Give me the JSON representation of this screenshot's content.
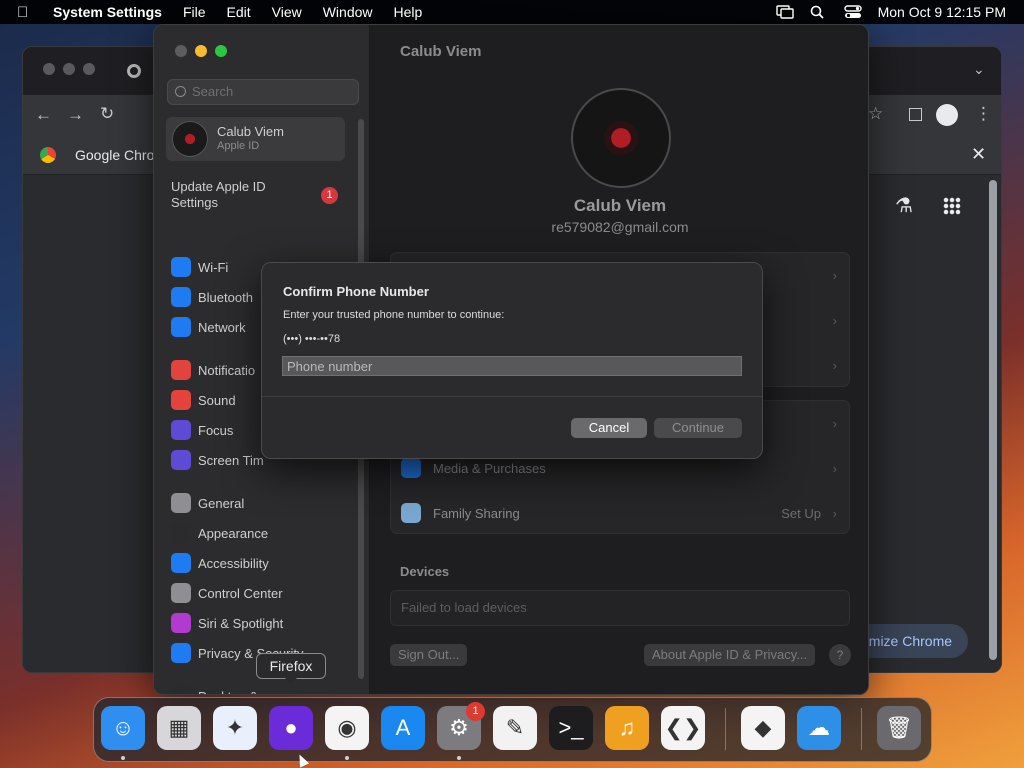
{
  "menubar": {
    "app": "System Settings",
    "items": [
      "File",
      "Edit",
      "View",
      "Window",
      "Help"
    ],
    "clock": "Mon Oct 9  12:15 PM"
  },
  "chrome": {
    "bookmark": "Google Chrom",
    "customize": "omize Chrome"
  },
  "settings": {
    "title": "Calub Viem",
    "search_placeholder": "Search",
    "account": {
      "name": "Calub Viem",
      "sub": "Apple ID"
    },
    "update": {
      "label": "Update Apple ID Settings",
      "badge": "1"
    },
    "sidebar": [
      {
        "label": "Wi-Fi",
        "icon": "wifi-icon",
        "color": "#1f7bf2"
      },
      {
        "label": "Bluetooth",
        "icon": "bluetooth-icon",
        "color": "#1f7bf2"
      },
      {
        "label": "Network",
        "icon": "globe-icon",
        "color": "#1f7bf2"
      },
      {
        "label": "Notificatio",
        "icon": "bell-icon",
        "color": "#e2443d"
      },
      {
        "label": "Sound",
        "icon": "speaker-icon",
        "color": "#e2443d"
      },
      {
        "label": "Focus",
        "icon": "moon-icon",
        "color": "#5d4bd6"
      },
      {
        "label": "Screen Tim",
        "icon": "hourglass-icon",
        "color": "#5d4bd6"
      },
      {
        "label": "General",
        "icon": "gear-icon",
        "color": "#8e8e93"
      },
      {
        "label": "Appearance",
        "icon": "appearance-icon",
        "color": "#2b2b2d"
      },
      {
        "label": "Accessibility",
        "icon": "accessibility-icon",
        "color": "#1f7bf2"
      },
      {
        "label": "Control Center",
        "icon": "control-center-icon",
        "color": "#8e8e93"
      },
      {
        "label": "Siri & Spotlight",
        "icon": "siri-icon",
        "color": "#b23ad1"
      },
      {
        "label": "Privacy & Security",
        "icon": "hand-icon",
        "color": "#1f7bf2"
      },
      {
        "label": "Desktop &",
        "icon": "desktop-icon",
        "color": "#2b2b2d"
      }
    ],
    "profile": {
      "name": "Calub Viem",
      "email": "re579082@gmail.com"
    },
    "rows": [
      {
        "label": "Media & Purchases",
        "value": ""
      },
      {
        "label": "Family Sharing",
        "value": "Set Up"
      }
    ],
    "devices_heading": "Devices",
    "devices_failed": "Failed to load devices",
    "sign_out": "Sign Out...",
    "about": "About Apple ID & Privacy...",
    "help": "?"
  },
  "dialog": {
    "title": "Confirm Phone Number",
    "text": "Enter your trusted phone number to continue:",
    "masked": "(•••) •••-••78",
    "placeholder": "Phone number",
    "cancel": "Cancel",
    "continue": "Continue"
  },
  "tooltip": "Firefox",
  "dock": {
    "badge": "1",
    "apps": [
      {
        "name": "finder",
        "glyph": "☺",
        "color": "#2f8ff0"
      },
      {
        "name": "launchpad",
        "glyph": "▦",
        "color": "#d7d7db"
      },
      {
        "name": "safari",
        "glyph": "✦",
        "color": "#e8f0fb"
      },
      {
        "name": "firefox",
        "glyph": "●",
        "color": "#6c2bd9"
      },
      {
        "name": "chrome",
        "glyph": "◉",
        "color": "#f4f4f4"
      },
      {
        "name": "app-store",
        "glyph": "A",
        "color": "#1b87f0"
      },
      {
        "name": "system-settings",
        "glyph": "⚙",
        "color": "#7b7b80"
      },
      {
        "name": "textedit",
        "glyph": "✎",
        "color": "#f2f2f2"
      },
      {
        "name": "terminal",
        "glyph": ">_",
        "color": "#1d1d1f"
      },
      {
        "name": "garageband",
        "glyph": "♫",
        "color": "#f0a020"
      },
      {
        "name": "vscode",
        "glyph": "❮❯",
        "color": "#f4f4f4"
      },
      {
        "name": "visual-studio",
        "glyph": "◆",
        "color": "#f4f4f4"
      },
      {
        "name": "weather",
        "glyph": "☁",
        "color": "#2d8fe6"
      },
      {
        "name": "trash",
        "glyph": "🗑",
        "color": "#6a6a6e"
      }
    ]
  }
}
